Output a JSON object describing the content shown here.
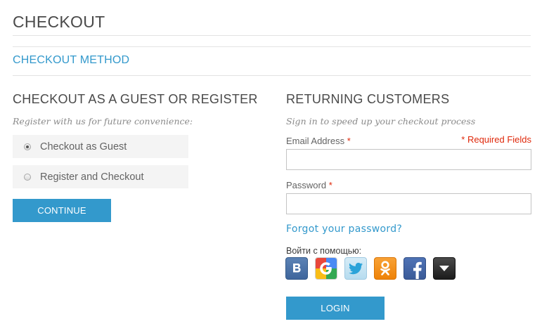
{
  "page": {
    "title": "CHECKOUT"
  },
  "step": {
    "title": "CHECKOUT METHOD"
  },
  "guest": {
    "heading": "CHECKOUT AS A GUEST OR REGISTER",
    "subtitle": "Register with us for future convenience:",
    "options": [
      {
        "label": "Checkout as Guest",
        "checked": true
      },
      {
        "label": "Register and Checkout",
        "checked": false
      }
    ],
    "continue_label": "CONTINUE"
  },
  "login": {
    "heading": "RETURNING CUSTOMERS",
    "subtitle": "Sign in to speed up your checkout process",
    "email_label": "Email Address",
    "password_label": "Password",
    "required_star": "*",
    "required_note": "* Required Fields",
    "email_value": "",
    "password_value": "",
    "forgot_label": "Forgot your password?",
    "social_label": "Войти с помощью:",
    "social_icons": [
      "vkontakte-icon",
      "google-icon",
      "twitter-icon",
      "odnoklassniki-icon",
      "facebook-icon",
      "more-dropdown-icon"
    ],
    "login_label": "LOGIN"
  },
  "colors": {
    "accent": "#3399cc",
    "required": "#df280a",
    "heading": "#4a4a4a",
    "option_bg": "#f4f4f4"
  }
}
